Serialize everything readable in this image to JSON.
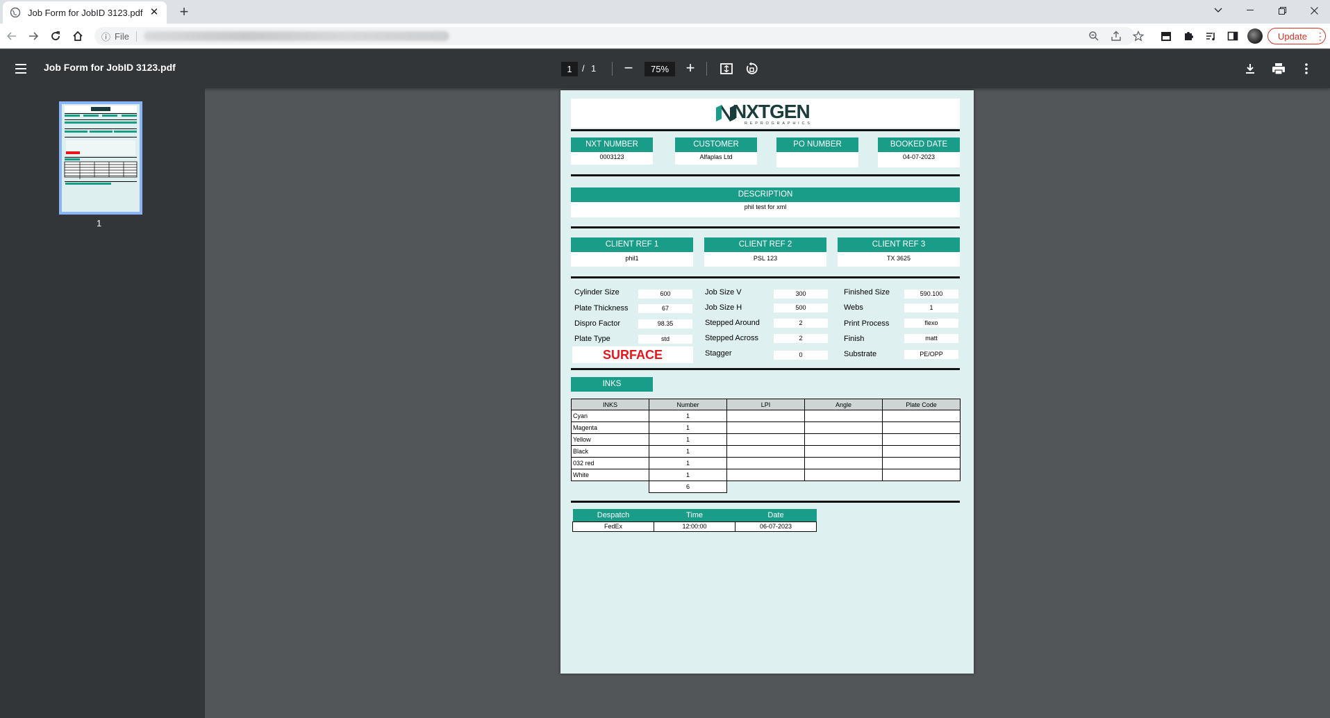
{
  "browser": {
    "tab_title": "Job Form for JobID 3123.pdf",
    "tab_close": "✕",
    "new_tab": "+",
    "scheme": "File",
    "update_label": "Update"
  },
  "viewer": {
    "title": "Job Form for JobID 3123.pdf",
    "page_current": "1",
    "page_sep": "/",
    "page_total": "1",
    "zoom": "75%",
    "thumbnail_label": "1"
  },
  "document": {
    "logo_text": "NXTGEN",
    "logo_sub": "REPROGRAPHICS",
    "top_fields": [
      {
        "label": "NXT NUMBER",
        "value": "0003123"
      },
      {
        "label": "CUSTOMER",
        "value": "Alfaplas Ltd"
      },
      {
        "label": "PO NUMBER",
        "value": ""
      },
      {
        "label": "BOOKED DATE",
        "value": "04-07-2023"
      }
    ],
    "description": {
      "label": "DESCRIPTION",
      "value": "phil test for xml"
    },
    "client_refs": [
      {
        "label": "CLIENT REF 1",
        "value": "phil1"
      },
      {
        "label": "CLIENT REF 2",
        "value": "PSL 123"
      },
      {
        "label": "CLIENT REF 3",
        "value": "TX 3625"
      }
    ],
    "specs": {
      "col1": [
        {
          "label": "Cylinder Size",
          "value": "600"
        },
        {
          "label": "Plate Thickness",
          "value": "67"
        },
        {
          "label": "Dispro Factor",
          "value": "98.35"
        },
        {
          "label": "Plate Type",
          "value": "std"
        }
      ],
      "col2": [
        {
          "label": "Job Size V",
          "value": "300"
        },
        {
          "label": "Job Size H",
          "value": "500"
        },
        {
          "label": "Stepped Around",
          "value": "2"
        },
        {
          "label": "Stepped Across",
          "value": "2"
        },
        {
          "label": "Stagger",
          "value": "0"
        }
      ],
      "col3": [
        {
          "label": "Finished Size",
          "value": "590.100"
        },
        {
          "label": "Webs",
          "value": "1"
        },
        {
          "label": "Print Process",
          "value": "flexo"
        },
        {
          "label": "Finish",
          "value": "matt"
        },
        {
          "label": "Substrate",
          "value": "PE/OPP"
        }
      ],
      "surface": "SURFACE"
    },
    "inks": {
      "label": "INKS",
      "columns": [
        "INKS",
        "Number",
        "LPI",
        "Angle",
        "Plate Code"
      ],
      "rows": [
        {
          "name": "Cyan",
          "number": "1"
        },
        {
          "name": "Magenta",
          "number": "1"
        },
        {
          "name": "Yellow",
          "number": "1"
        },
        {
          "name": "Black",
          "number": "1"
        },
        {
          "name": "032 red",
          "number": "1"
        },
        {
          "name": "White",
          "number": "1"
        }
      ],
      "total": "6"
    },
    "despatch": {
      "columns": [
        "Despatch",
        "Time",
        "Date"
      ],
      "values": [
        "FedEx",
        "12:00:00",
        "06-07-2023"
      ]
    }
  },
  "colors": {
    "accent": "#1a9d88",
    "surface_red": "#e8141b",
    "page_bg": "#dff0f0"
  }
}
